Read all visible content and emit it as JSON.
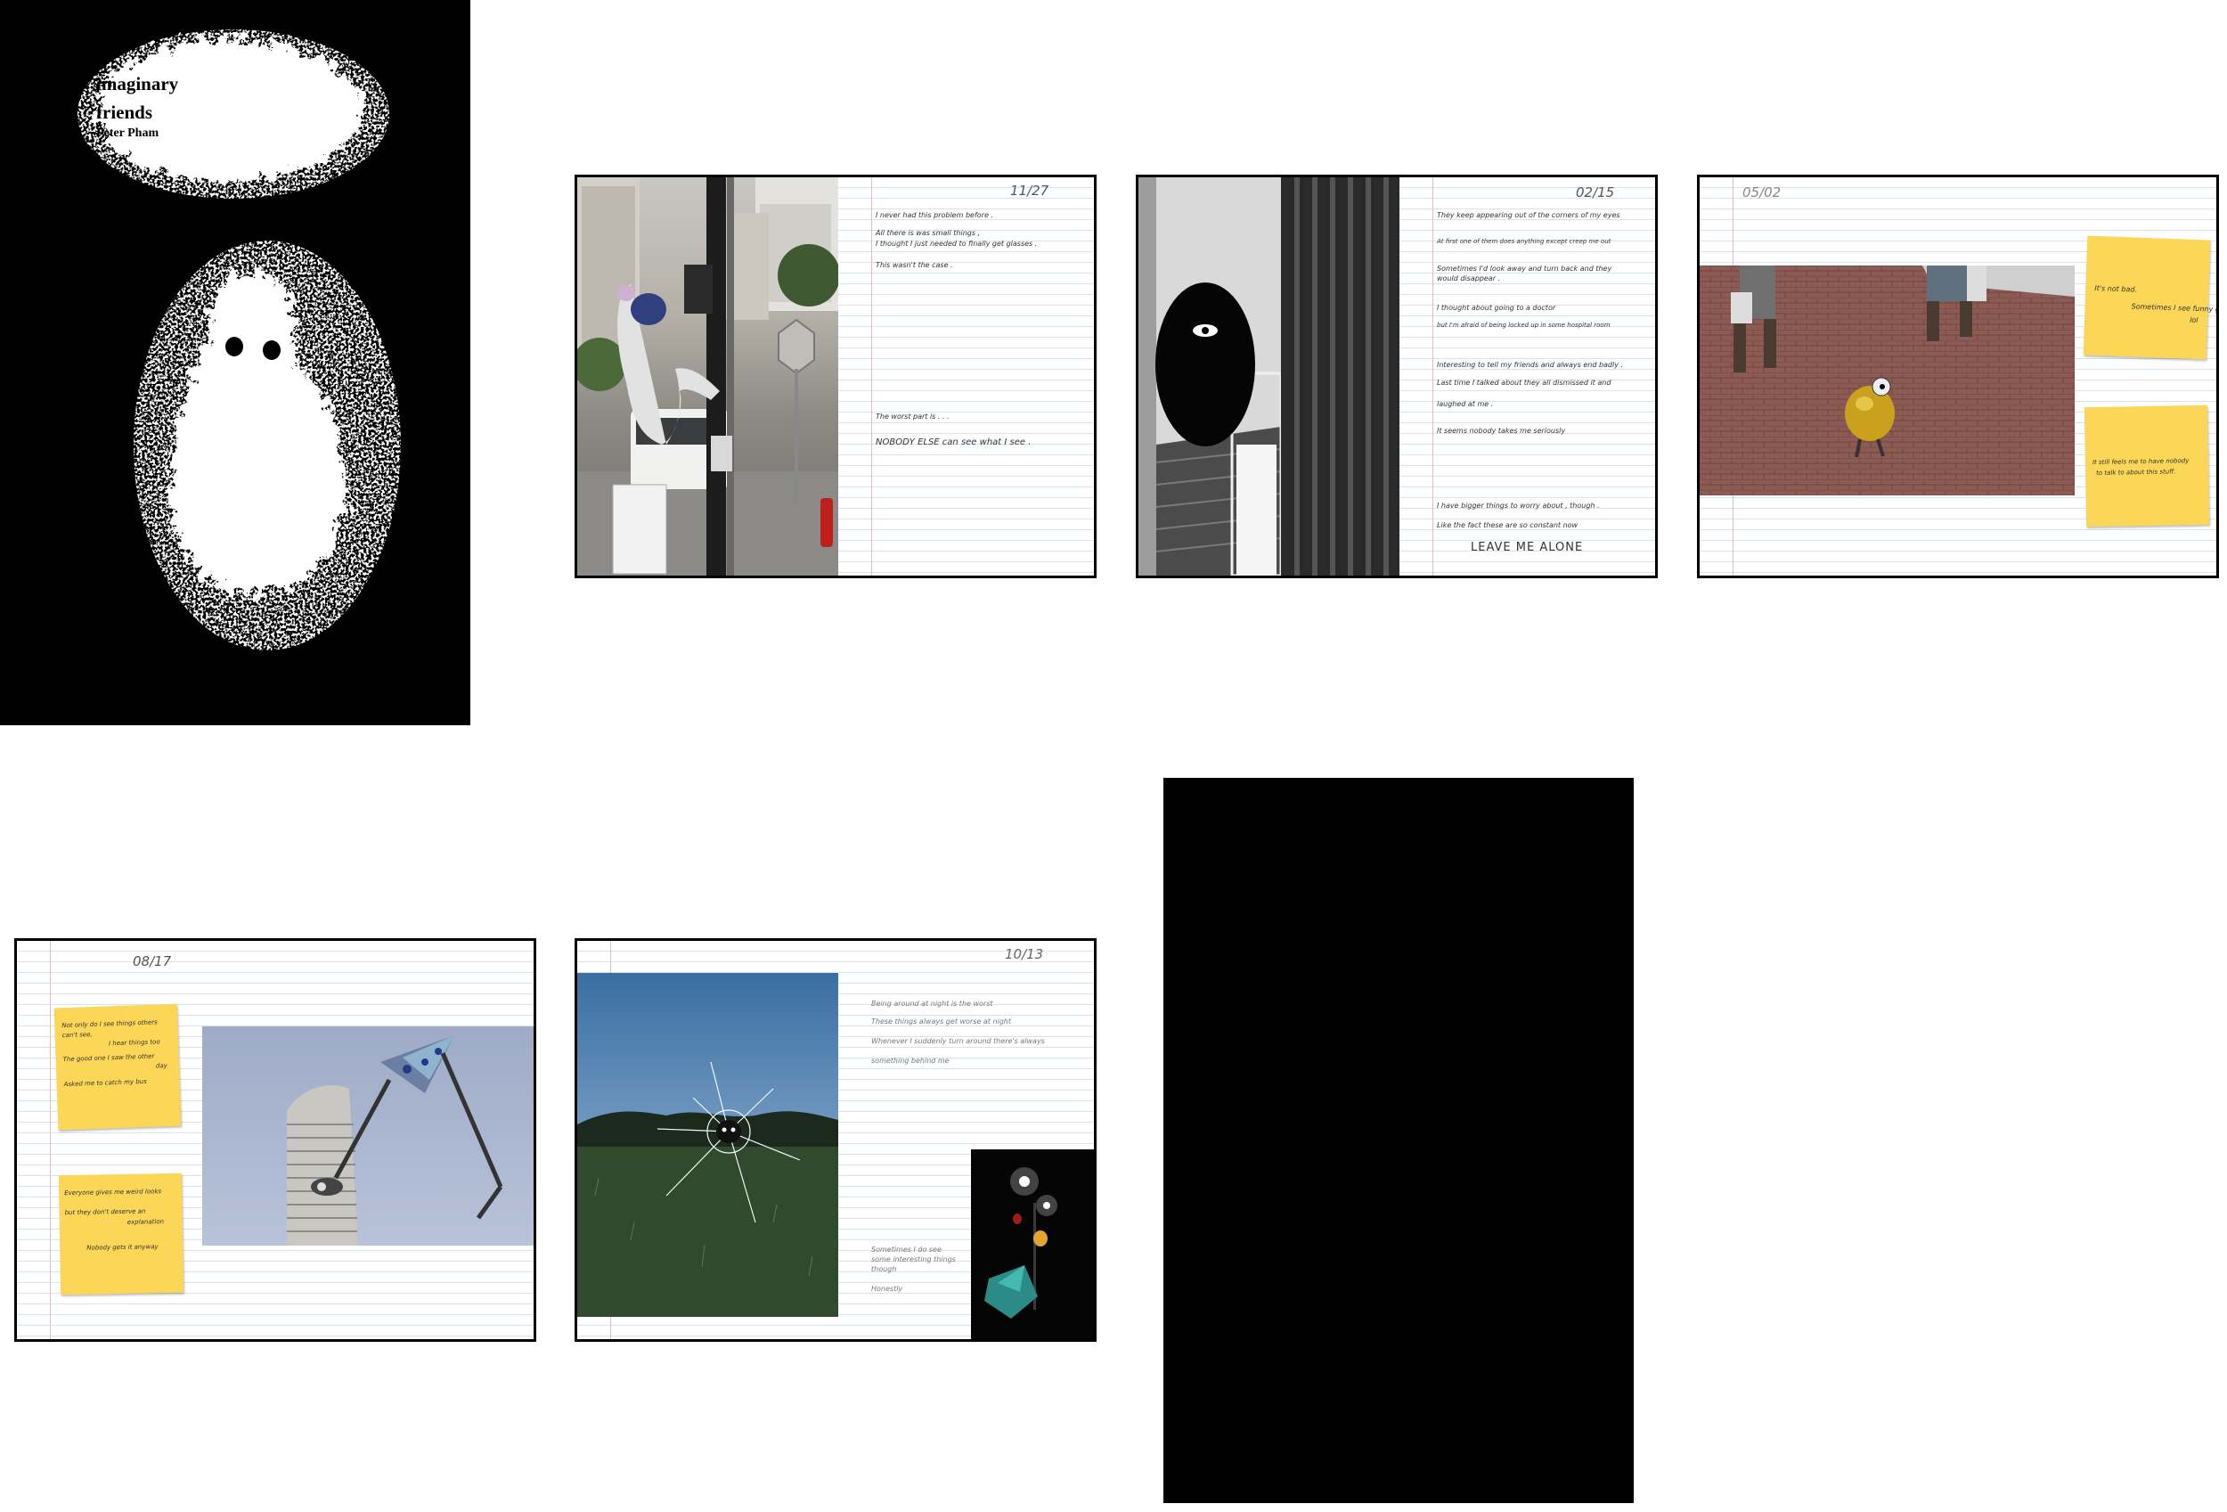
{
  "cover": {
    "title_line1": "imaginary",
    "title_line2": "friends",
    "author": "Peter Pham"
  },
  "spread1": {
    "date": "11/27",
    "lines": [
      "I never had this problem before .",
      "All there is was small things ,",
      "I thought I just needed to finally get glasses .",
      "This wasn't the case .",
      "The worst part is . . .",
      "NOBODY ELSE can see what I see ."
    ]
  },
  "spread2": {
    "date": "02/15",
    "lines": [
      "They keep appearing out of the corners of my eyes",
      "At first one of them does anything except creep me out",
      "Sometimes I'd look away and turn back and they",
      "would disappear .",
      "I thought about going to a doctor",
      "but I'm afraid of being locked up in some hospital room",
      "Interesting to tell my friends and always end badly .",
      "Last time I talked about they all dismissed it and",
      "laughed at me .",
      "It seems nobody takes me seriously",
      "I have bigger things to worry about , though .",
      "Like the fact these are so constant now",
      "LEAVE ME ALONE"
    ]
  },
  "spread3": {
    "date": "05/02",
    "note1_lines": [
      "It's not bad.",
      "Sometimes I see funny guys",
      "lol"
    ],
    "note2_lines": [
      "It still feels me to have nobody",
      "to talk to about this stuff."
    ]
  },
  "spread4": {
    "date": "08/17",
    "note1_lines": [
      "Not only do I see things others",
      "can't see,",
      "I hear things too",
      "The good one I saw the other",
      "day",
      "Asked me to catch my bus"
    ],
    "note2_lines": [
      "Everyone gives me weird looks",
      "but they don't deserve an",
      "explanation",
      "Nobody gets it anyway"
    ]
  },
  "spread5": {
    "date": "10/13",
    "lines": [
      "Being around at night is the worst",
      "These things always get worse at night",
      "Whenever I suddenly turn around there's always",
      "something behind me"
    ],
    "bottom_lines": [
      "Sometimes I do see",
      "some interesting things",
      "though",
      "Honestly"
    ]
  },
  "colors": {
    "background": "#ffffff",
    "black": "#000000",
    "sticky_note": "#fcd657",
    "ruled_line": "#d5e4ef",
    "margin_line": "#e3b9c2"
  }
}
